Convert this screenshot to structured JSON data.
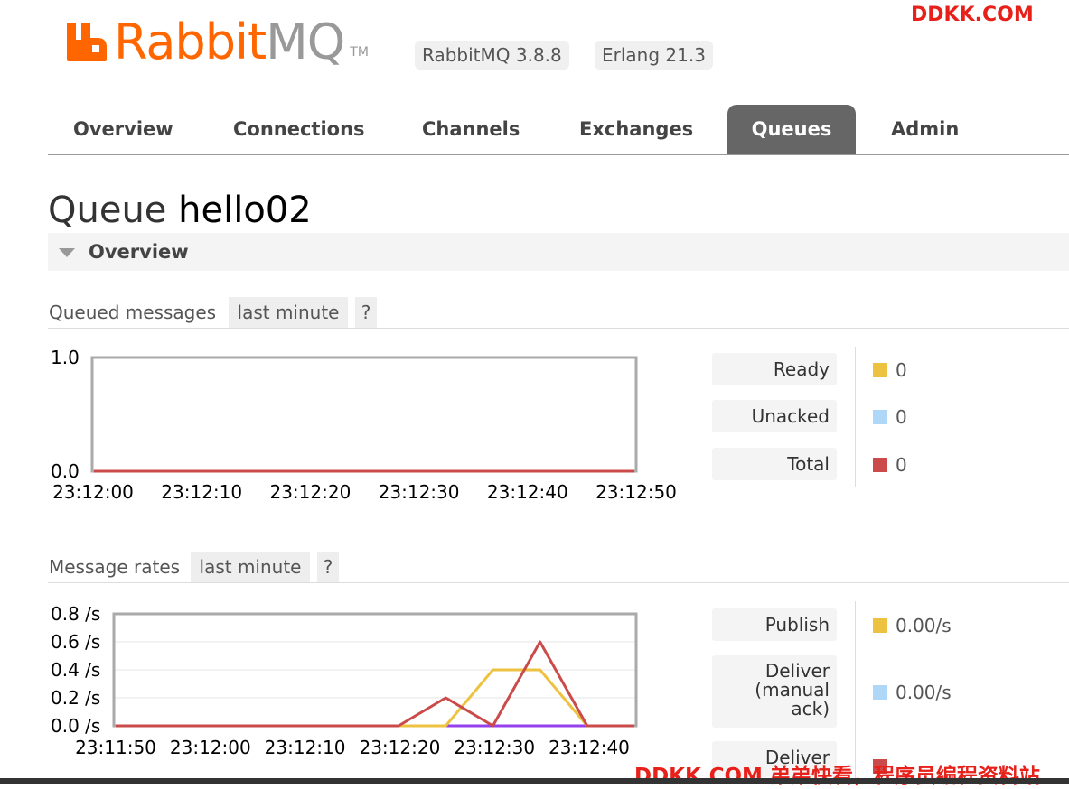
{
  "header": {
    "logo_text_rabbit": "Rabbit",
    "logo_text_mq": "MQ",
    "logo_tm": "TM",
    "rabbitmq_version": "RabbitMQ 3.8.8",
    "erlang_version": "Erlang 21.3"
  },
  "watermark": {
    "top": "DDKK.COM",
    "bottom": "DDKK.COM 弟弟快看，程序员编程资料站"
  },
  "tabs": [
    {
      "label": "Overview",
      "active": false
    },
    {
      "label": "Connections",
      "active": false
    },
    {
      "label": "Channels",
      "active": false
    },
    {
      "label": "Exchanges",
      "active": false
    },
    {
      "label": "Queues",
      "active": true
    },
    {
      "label": "Admin",
      "active": false
    }
  ],
  "page": {
    "title_prefix": "Queue",
    "queue_name": "hello02",
    "section": "Overview"
  },
  "queued_messages": {
    "title": "Queued messages",
    "range": "last minute",
    "help": "?",
    "legend": [
      {
        "label": "Ready",
        "value": "0",
        "color": "#edc240"
      },
      {
        "label": "Unacked",
        "value": "0",
        "color": "#afd8f8"
      },
      {
        "label": "Total",
        "value": "0",
        "color": "#cb4b4b"
      }
    ]
  },
  "message_rates": {
    "title": "Message rates",
    "range": "last minute",
    "help": "?",
    "legend": [
      {
        "label": "Publish",
        "value": "0.00/s",
        "color": "#edc240"
      },
      {
        "label": "Deliver (manual ack)",
        "value": "0.00/s",
        "color": "#afd8f8"
      },
      {
        "label": "Deliver",
        "value": "",
        "color": "#cb4b4b"
      }
    ]
  },
  "chart_data": [
    {
      "type": "line",
      "ytick_labels": [
        "1.0",
        "0.0"
      ],
      "ylim": [
        0,
        1
      ],
      "x": [
        "23:12:00",
        "23:12:10",
        "23:12:20",
        "23:12:30",
        "23:12:40",
        "23:12:50"
      ],
      "grid": false,
      "series": [
        {
          "values": [
            0,
            0,
            0,
            0,
            0,
            0
          ],
          "color": "#cb4b4b"
        }
      ]
    },
    {
      "type": "line",
      "ytick_labels": [
        "0.8 /s",
        "0.6 /s",
        "0.4 /s",
        "0.2 /s",
        "0.0 /s"
      ],
      "ylim": [
        0,
        0.8
      ],
      "x": [
        "23:11:50",
        "23:12:00",
        "23:12:10",
        "23:12:20",
        "23:12:30",
        "23:12:40"
      ],
      "points_per_tick": 2,
      "grid": true,
      "series": [
        {
          "values": [
            0,
            0,
            0,
            0,
            0,
            0,
            0,
            0,
            0,
            0,
            0,
            0
          ],
          "color": "#9440ed"
        },
        {
          "values": [
            0,
            0,
            0,
            0,
            0,
            0,
            0,
            0,
            0.4,
            0.4,
            0,
            0
          ],
          "color": "#edc240"
        },
        {
          "values": [
            0,
            0,
            0,
            0,
            0,
            0,
            0,
            0.2,
            0,
            0.6,
            0,
            0
          ],
          "color": "#cb4b4b"
        }
      ]
    }
  ]
}
